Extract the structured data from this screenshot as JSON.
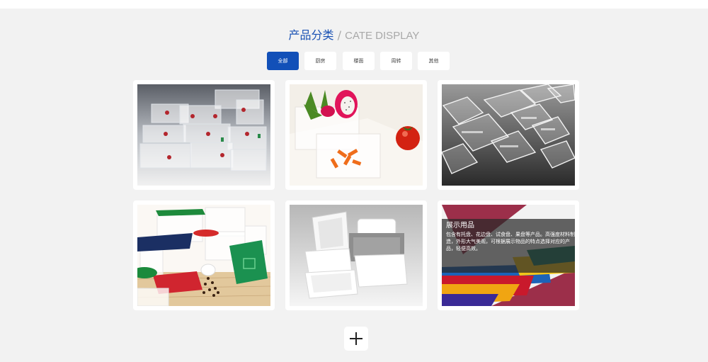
{
  "header": {
    "title_zh": "产品分类",
    "separator": " / ",
    "title_en": "CATE DISPLAY"
  },
  "tabs": [
    {
      "label": "全部",
      "active": true
    },
    {
      "label": "厨房",
      "active": false
    },
    {
      "label": "楼面",
      "active": false
    },
    {
      "label": "周转",
      "active": false
    },
    {
      "label": "其他",
      "active": false
    }
  ],
  "products": [
    {
      "image": "storage-containers-photo"
    },
    {
      "image": "fruit-container-photo"
    },
    {
      "image": "gastronorm-pans-photo"
    },
    {
      "image": "square-containers-photo"
    },
    {
      "image": "bus-tubs-photo"
    },
    {
      "image": "display-trays-photo",
      "overlay_title": "展示用品",
      "overlay_desc": "包含有托盘、花边盘、试食盘、果盘等产品。高强度材料制造，外形大气美观，可根据展示物品的特点选择对应的产品，轻便高效。"
    }
  ],
  "more_button": {
    "icon": "plus-icon"
  },
  "colors": {
    "accent": "#1250b8",
    "title": "#1a52b4",
    "background": "#f2f2f2"
  }
}
